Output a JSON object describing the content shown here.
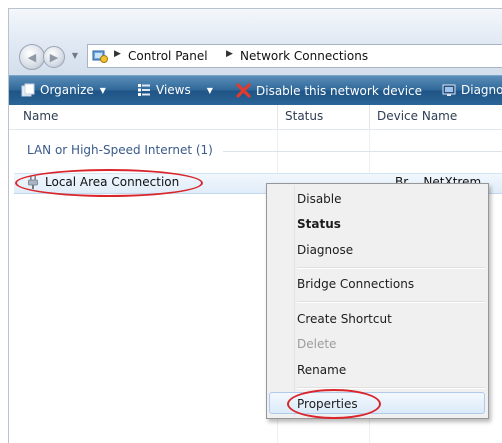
{
  "address_bar": {
    "breadcrumbs": [
      "Control Panel",
      "Network Connections"
    ]
  },
  "toolbar": {
    "organize_label": "Organize",
    "views_label": "Views",
    "disable_label": "Disable this network device",
    "diagnose_label": "Diagno"
  },
  "columns": {
    "name": "Name",
    "status": "Status",
    "device_name": "Device Name"
  },
  "group": {
    "label": "LAN or High-Speed Internet (1)"
  },
  "connection": {
    "name": "Local Area Connection",
    "device_partial": "Br     ...NetXtrem"
  },
  "context_menu": {
    "items": [
      "Disable",
      "Status",
      "Diagnose",
      "Bridge Connections",
      "Create Shortcut",
      "Delete",
      "Rename",
      "Properties"
    ]
  },
  "colors": {
    "toolbar": "#2f6899",
    "annotation": "#d9262c",
    "menu_bg": "#f0f0f0"
  }
}
